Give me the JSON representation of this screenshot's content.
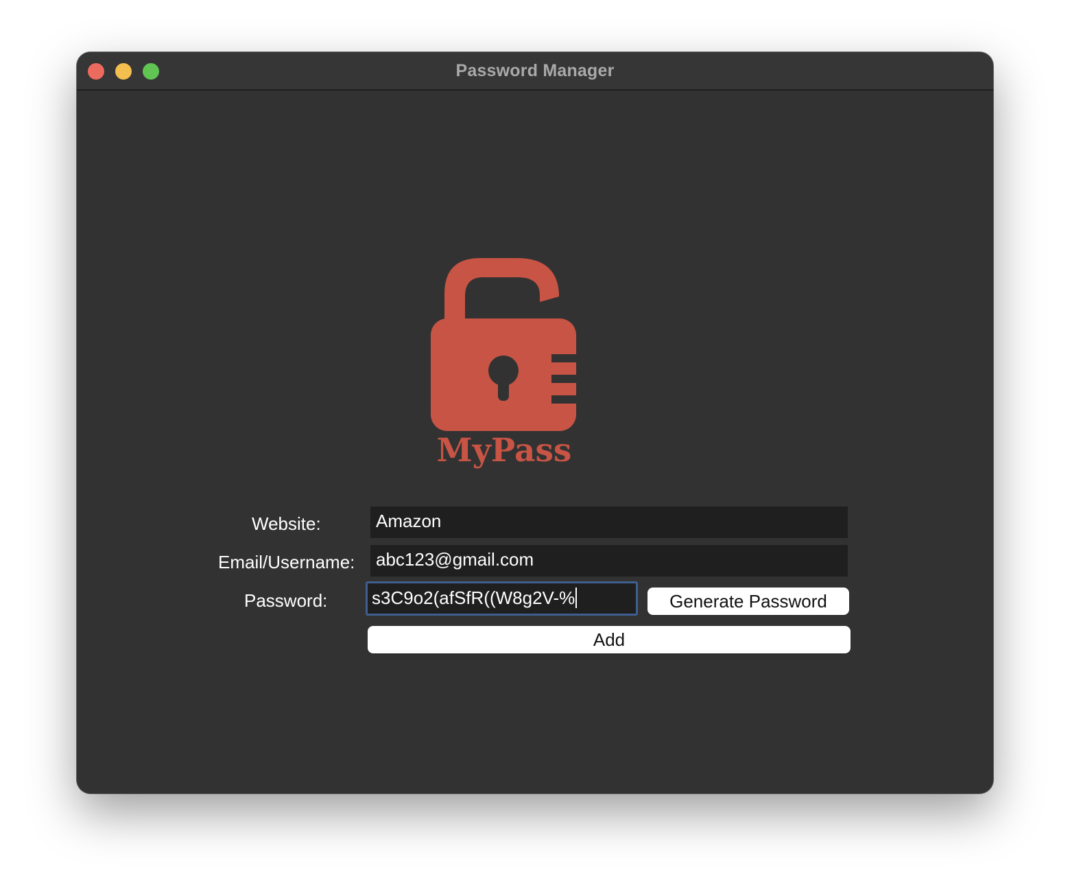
{
  "window": {
    "title": "Password Manager"
  },
  "logo": {
    "text": "MyPass",
    "icon": "padlock-icon",
    "color": "#c75444"
  },
  "form": {
    "website": {
      "label": "Website:",
      "value": "Amazon"
    },
    "email": {
      "label": "Email/Username:",
      "value": "abc123@gmail.com"
    },
    "password": {
      "label": "Password:",
      "value": "s3C9o2(afSfR((W8g2V-%"
    },
    "generate_button": "Generate Password",
    "add_button": "Add"
  },
  "colors": {
    "window_bg": "#323232",
    "field_bg": "#1f1f1f",
    "focus_ring": "#3f5f91",
    "close": "#ed6a5e",
    "minimize": "#f5bf4f",
    "maximize": "#61c554"
  }
}
